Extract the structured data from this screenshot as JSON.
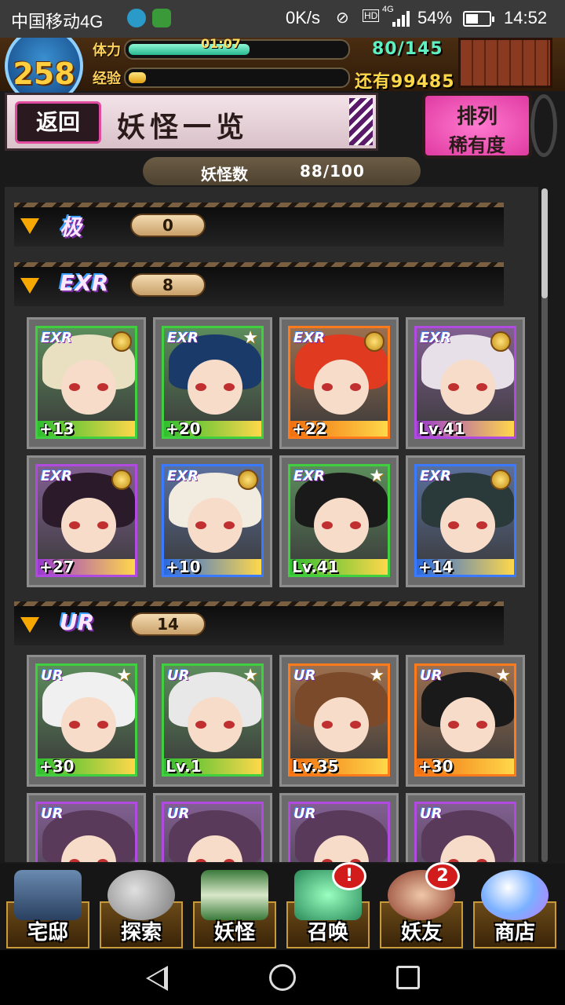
{
  "status_bar": {
    "carrier": "中国移动4G",
    "speed": "0K/s",
    "network": "4G",
    "battery": "54%",
    "battery_level": 0.54,
    "time": "14:52"
  },
  "player": {
    "level": "258",
    "stamina_label": "体力",
    "stamina_timer": "01:07",
    "stamina_value": "80/145",
    "stamina_fill": 0.55,
    "exp_label": "经验",
    "exp_remaining": "还有99485",
    "exp_fill": 0.08
  },
  "header": {
    "back_label": "返回",
    "title": "妖怪一览",
    "sort_label": "排列",
    "sort_value": "稀有度"
  },
  "count_bar": {
    "label": "妖怪数",
    "value": "88/100"
  },
  "sections": [
    {
      "tag": "极",
      "count": "0"
    },
    {
      "tag": "EXR",
      "count": "8"
    },
    {
      "tag": "UR",
      "count": "14"
    }
  ],
  "exr_cards": [
    {
      "badge": "EXR",
      "label": "+13",
      "medal": true,
      "bottom_color": "#2fbf2f",
      "frame_color": "#3fcf3f"
    },
    {
      "badge": "EXR",
      "label": "+20",
      "medal": false,
      "bottom_color": "#2fbf2f",
      "frame_color": "#3fcf3f"
    },
    {
      "badge": "EXR",
      "label": "+22",
      "medal": true,
      "bottom_color": "#f07010",
      "frame_color": "#ff7a1a"
    },
    {
      "badge": "EXR",
      "label": "Lv.41",
      "medal": true,
      "bottom_color": "#9a3ad0",
      "frame_color": "#b04ae0"
    },
    {
      "badge": "EXR",
      "label": "+27",
      "medal": true,
      "bottom_color": "#9a3ad0",
      "frame_color": "#b04ae0"
    },
    {
      "badge": "EXR",
      "label": "+10",
      "medal": true,
      "bottom_color": "#2a6ae0",
      "frame_color": "#3a7aff"
    },
    {
      "badge": "EXR",
      "label": "Lv.41",
      "medal": false,
      "bottom_color": "#2fbf2f",
      "frame_color": "#3fcf3f"
    },
    {
      "badge": "EXR",
      "label": "+14",
      "medal": true,
      "bottom_color": "#2a6ae0",
      "frame_color": "#3a7aff"
    }
  ],
  "ur_cards": [
    {
      "badge": "UR",
      "label": "+30",
      "medal": false,
      "bottom_color": "#2fbf2f",
      "frame_color": "#3fcf3f"
    },
    {
      "badge": "UR",
      "label": "Lv.1",
      "medal": false,
      "bottom_color": "#2fbf2f",
      "frame_color": "#3fcf3f"
    },
    {
      "badge": "UR",
      "label": "Lv.35",
      "medal": false,
      "bottom_color": "#f07010",
      "frame_color": "#ff7a1a"
    },
    {
      "badge": "UR",
      "label": "+30",
      "medal": false,
      "bottom_color": "#f07010",
      "frame_color": "#ff7a1a"
    }
  ],
  "ur_partial_cards": [
    {
      "badge": "UR",
      "frame_color": "#b04ae0"
    },
    {
      "badge": "UR",
      "frame_color": "#b04ae0"
    },
    {
      "badge": "UR",
      "frame_color": "#b04ae0"
    },
    {
      "badge": "UR",
      "frame_color": "#b04ae0"
    }
  ],
  "menu": [
    {
      "label": "宅邸",
      "icon": "house-icon",
      "notif": ""
    },
    {
      "label": "探索",
      "icon": "magnifier-icon",
      "notif": ""
    },
    {
      "label": "妖怪",
      "icon": "scroll-icon",
      "notif": ""
    },
    {
      "label": "召唤",
      "icon": "pentagram-icon",
      "notif": "!"
    },
    {
      "label": "妖友",
      "icon": "fox-girl-icon",
      "notif": "2"
    },
    {
      "label": "商店",
      "icon": "crystal-orb-icon",
      "notif": ""
    }
  ],
  "colors": {
    "accent_pink": "#e04ca0",
    "gold": "#ffd84a",
    "teal": "#5ef0c0"
  }
}
